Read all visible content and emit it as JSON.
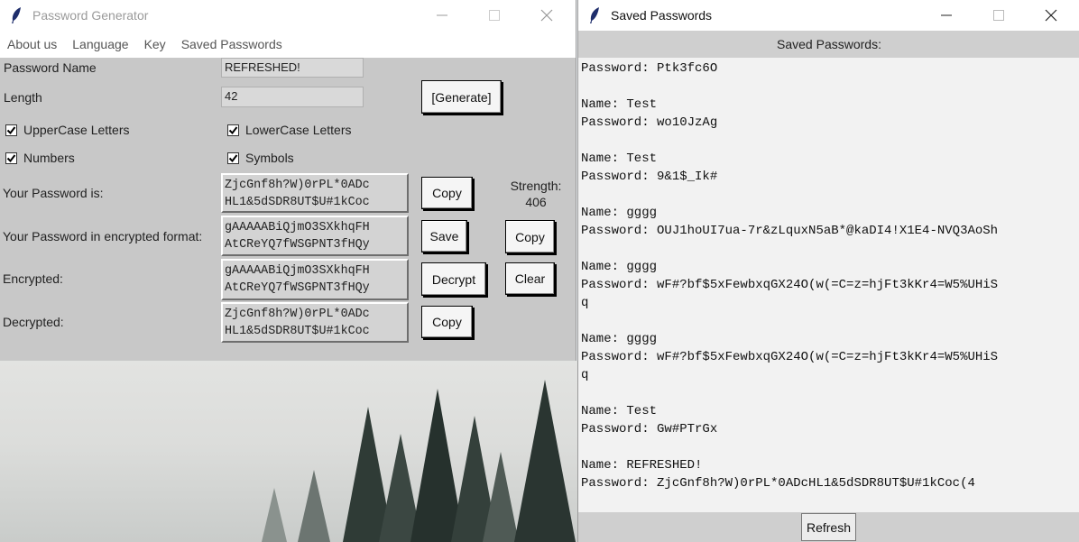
{
  "main_window": {
    "title": "Password Generator",
    "menu": [
      "About us",
      "Language",
      "Key",
      "Saved Passwords"
    ],
    "password_name_label": "Password Name",
    "password_name_value": "REFRESHED!",
    "length_label": "Length",
    "length_value": "42",
    "generate_label": "[Generate]",
    "checkboxes": {
      "uppercase": {
        "label": "UpperCase Letters",
        "checked": true
      },
      "lowercase": {
        "label": "LowerCase Letters",
        "checked": true
      },
      "numbers": {
        "label": "Numbers",
        "checked": true
      },
      "symbols": {
        "label": "Symbols",
        "checked": true
      }
    },
    "your_password_label": "Your Password is:",
    "your_password_value": "ZjcGnf8h?W)0rPL*0ADc\nHL1&5dSDR8UT$U#1kCoc",
    "encrypted_format_label": "Your Password in encrypted format:",
    "encrypted_format_value": "gAAAAABiQjmO3SXkhqFH\nAtCReYQ7fWSGPNT3fHQy",
    "encrypted_label": "Encrypted:",
    "encrypted_value": "gAAAAABiQjmO3SXkhqFH\nAtCReYQ7fWSGPNT3fHQy",
    "decrypted_label": "Decrypted:",
    "decrypted_value": "ZjcGnf8h?W)0rPL*0ADc\nHL1&5dSDR8UT$U#1kCoc",
    "strength_label": "Strength:",
    "strength_value": "406",
    "buttons": {
      "copy_password": "Copy",
      "save": "Save",
      "copy_encrypted": "Copy",
      "decrypt": "Decrypt",
      "clear": "Clear",
      "copy_decrypted": "Copy"
    }
  },
  "saved_window": {
    "title": "Saved Passwords",
    "header": "Saved Passwords:",
    "content": "Password: Ptk3fc6O\n\nName: Test\nPassword: wo10JzAg\n\nName: Test\nPassword: 9&1$_Ik#\n\nName: gggg\nPassword: OUJ1hoUI7ua-7r&zLquxN5aB*@kaDI4!X1E4-NVQ3AoSh\n\nName: gggg\nPassword: wF#?bf$5xFewbxqGX24O(w(=C=z=hjFt3kKr4=W5%UHiS\nq\n\nName: gggg\nPassword: wF#?bf$5xFewbxqGX24O(w(=C=z=hjFt3kKr4=W5%UHiS\nq\n\nName: Test\nPassword: Gw#PTrGx\n\nName: REFRESHED!\nPassword: ZjcGnf8h?W)0rPL*0ADcHL1&5dSDR8UT$U#1kCoc(4",
    "refresh_label": "Refresh"
  },
  "icons": [
    "feather-icon",
    "minimize-icon",
    "maximize-icon",
    "close-icon",
    "checkmark-icon"
  ]
}
